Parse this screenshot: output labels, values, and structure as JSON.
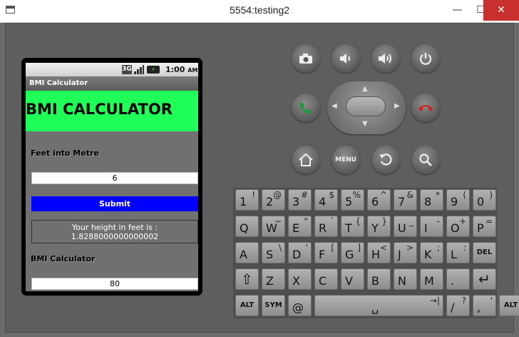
{
  "window": {
    "title": "5554:testing2",
    "minimize": "—",
    "maximize": "☐",
    "close": "✕"
  },
  "status_bar": {
    "network": "3G",
    "time": "1:00",
    "ampm": "AM",
    "battery": "⚡"
  },
  "app": {
    "title": "BMI Calculator",
    "banner": "BMI CALCULATOR",
    "feet_label": "Feet into Metre",
    "feet_value": "6",
    "submit_label": "Submit",
    "result_line1": "Your height in feet is :",
    "result_line2": "1.8288000000000002",
    "bmi_label": "BMI Calculator",
    "weight_value": "80"
  },
  "controls": {
    "camera": "camera-icon",
    "volume_down": "volume-down-icon",
    "volume_up": "volume-up-icon",
    "power": "power-icon",
    "call": "call-icon",
    "end_call": "end-call-icon",
    "home": "home-icon",
    "menu_label": "MENU",
    "back": "back-icon",
    "search": "search-icon",
    "call_color": "#1a9c3a",
    "end_call_color": "#d42020"
  },
  "keyboard": {
    "row1": [
      {
        "main": "1",
        "alt": "!"
      },
      {
        "main": "2",
        "alt": "@"
      },
      {
        "main": "3",
        "alt": "#"
      },
      {
        "main": "4",
        "alt": "$"
      },
      {
        "main": "5",
        "alt": "%"
      },
      {
        "main": "6",
        "alt": "^"
      },
      {
        "main": "7",
        "alt": "&"
      },
      {
        "main": "8",
        "alt": "*"
      },
      {
        "main": "9",
        "alt": "("
      },
      {
        "main": "0",
        "alt": ")"
      }
    ],
    "row2": [
      {
        "main": "Q",
        "alt": ""
      },
      {
        "main": "W",
        "alt": "~"
      },
      {
        "main": "E",
        "alt": "\""
      },
      {
        "main": "R",
        "alt": "`"
      },
      {
        "main": "T",
        "alt": "{"
      },
      {
        "main": "Y",
        "alt": "}"
      },
      {
        "main": "U",
        "alt": "_"
      },
      {
        "main": "I",
        "alt": "-"
      },
      {
        "main": "O",
        "alt": "+"
      },
      {
        "main": "P",
        "alt": "="
      }
    ],
    "row3": [
      {
        "main": "A",
        "alt": ""
      },
      {
        "main": "S",
        "alt": "\\"
      },
      {
        "main": "D",
        "alt": "'"
      },
      {
        "main": "F",
        "alt": "["
      },
      {
        "main": "G",
        "alt": "]"
      },
      {
        "main": "H",
        "alt": "<"
      },
      {
        "main": "J",
        "alt": ">"
      },
      {
        "main": "K",
        "alt": ";"
      },
      {
        "main": "L",
        "alt": ":"
      },
      {
        "main": "DEL",
        "alt": ""
      }
    ],
    "row4": [
      {
        "main": "⇧",
        "alt": ""
      },
      {
        "main": "Z",
        "alt": ""
      },
      {
        "main": "X",
        "alt": ""
      },
      {
        "main": "C",
        "alt": ""
      },
      {
        "main": "V",
        "alt": ""
      },
      {
        "main": "B",
        "alt": ""
      },
      {
        "main": "N",
        "alt": ""
      },
      {
        "main": "M",
        "alt": ""
      },
      {
        "main": ".",
        "alt": ""
      },
      {
        "main": "↵",
        "alt": ""
      }
    ],
    "row5": [
      {
        "main": "ALT",
        "alt": ""
      },
      {
        "main": "SYM",
        "alt": ""
      },
      {
        "main": "@",
        "alt": ""
      },
      {
        "main": "␣",
        "alt": "→|"
      },
      {
        "main": "/",
        "alt": "?"
      },
      {
        "main": ",",
        "alt": "'"
      },
      {
        "main": "ALT",
        "alt": ""
      }
    ]
  }
}
